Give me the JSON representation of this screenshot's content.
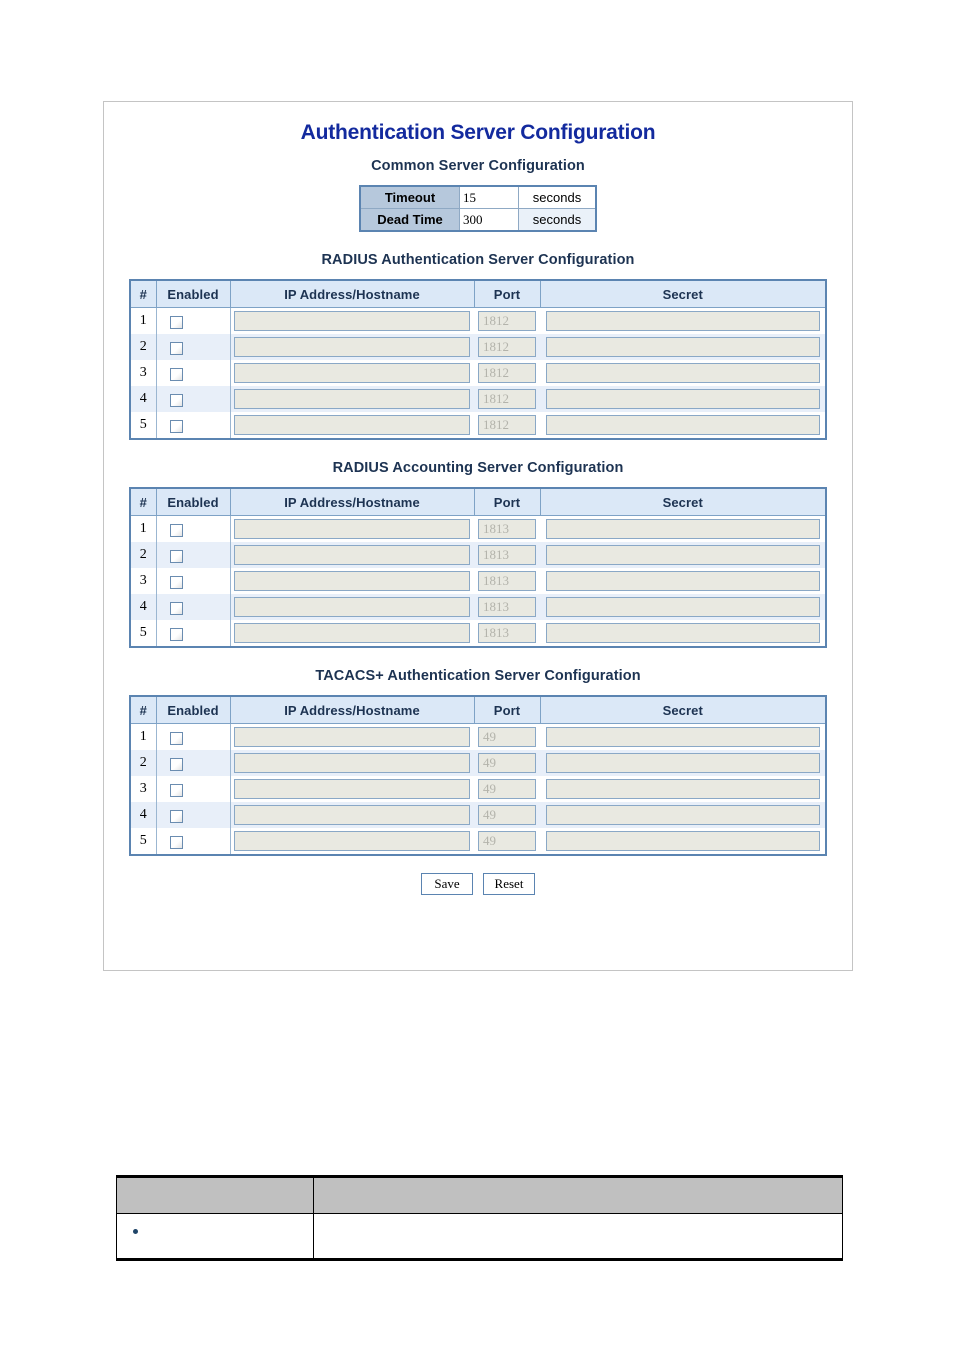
{
  "page": {
    "title": "Authentication Server Configuration"
  },
  "common": {
    "section_title": "Common Server Configuration",
    "rows": [
      {
        "label": "Timeout",
        "value": "15",
        "unit": "seconds"
      },
      {
        "label": "Dead Time",
        "value": "300",
        "unit": "seconds"
      }
    ]
  },
  "columns": {
    "num": "#",
    "enabled": "Enabled",
    "ip": "IP Address/Hostname",
    "port": "Port",
    "secret": "Secret"
  },
  "tables": [
    {
      "section_title": "RADIUS Authentication Server Configuration",
      "rows": [
        {
          "num": "1",
          "enabled": false,
          "ip": "",
          "port": "1812",
          "secret": ""
        },
        {
          "num": "2",
          "enabled": false,
          "ip": "",
          "port": "1812",
          "secret": ""
        },
        {
          "num": "3",
          "enabled": false,
          "ip": "",
          "port": "1812",
          "secret": ""
        },
        {
          "num": "4",
          "enabled": false,
          "ip": "",
          "port": "1812",
          "secret": ""
        },
        {
          "num": "5",
          "enabled": false,
          "ip": "",
          "port": "1812",
          "secret": ""
        }
      ]
    },
    {
      "section_title": "RADIUS Accounting Server Configuration",
      "rows": [
        {
          "num": "1",
          "enabled": false,
          "ip": "",
          "port": "1813",
          "secret": ""
        },
        {
          "num": "2",
          "enabled": false,
          "ip": "",
          "port": "1813",
          "secret": ""
        },
        {
          "num": "3",
          "enabled": false,
          "ip": "",
          "port": "1813",
          "secret": ""
        },
        {
          "num": "4",
          "enabled": false,
          "ip": "",
          "port": "1813",
          "secret": ""
        },
        {
          "num": "5",
          "enabled": false,
          "ip": "",
          "port": "1813",
          "secret": ""
        }
      ]
    },
    {
      "section_title": "TACACS+ Authentication Server Configuration",
      "rows": [
        {
          "num": "1",
          "enabled": false,
          "ip": "",
          "port": "49",
          "secret": ""
        },
        {
          "num": "2",
          "enabled": false,
          "ip": "",
          "port": "49",
          "secret": ""
        },
        {
          "num": "3",
          "enabled": false,
          "ip": "",
          "port": "49",
          "secret": ""
        },
        {
          "num": "4",
          "enabled": false,
          "ip": "",
          "port": "49",
          "secret": ""
        },
        {
          "num": "5",
          "enabled": false,
          "ip": "",
          "port": "49",
          "secret": ""
        }
      ]
    }
  ],
  "buttons": {
    "save": "Save",
    "reset": "Reset"
  },
  "doc_table": {
    "header": [
      "",
      ""
    ],
    "rows": [
      {
        "cells": [
          "",
          ""
        ],
        "bullet": true
      }
    ]
  },
  "colors": {
    "title": "#132a9e",
    "section_title": "#1d3352",
    "table_border": "#5b84b1",
    "header_bg": "#dbe8f7",
    "row_alt_bg": "#e8eff9",
    "field_bg": "#e9e9e1",
    "label_bg": "#b6c8dc",
    "doc_header_bg": "#c0c0c0",
    "bullet": "#1f4568"
  }
}
